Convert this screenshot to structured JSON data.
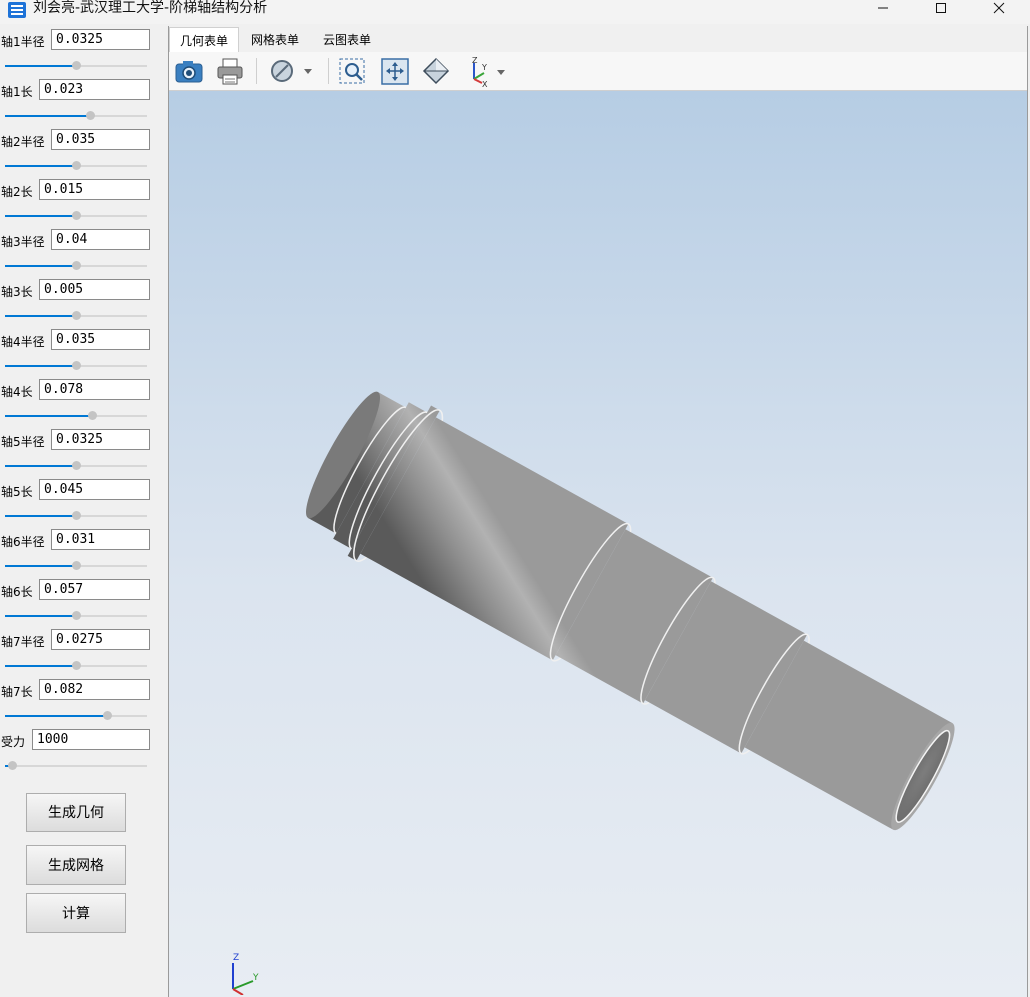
{
  "window": {
    "title": "刘会亮-武汉理工大学-阶梯轴结构分析",
    "controls": [
      "minimize-icon",
      "maximize-icon",
      "close-icon"
    ]
  },
  "params": [
    {
      "label": "轴1半径",
      "value": "0.0325",
      "slider": 0.5
    },
    {
      "label": "轴1长",
      "value": "0.023",
      "slider": 0.6
    },
    {
      "label": "轴2半径",
      "value": "0.035",
      "slider": 0.5
    },
    {
      "label": "轴2长",
      "value": "0.015",
      "slider": 0.5
    },
    {
      "label": "轴3半径",
      "value": "0.04",
      "slider": 0.5
    },
    {
      "label": "轴3长",
      "value": "0.005",
      "slider": 0.5
    },
    {
      "label": "轴4半径",
      "value": "0.035",
      "slider": 0.5
    },
    {
      "label": "轴4长",
      "value": "0.078",
      "slider": 0.61
    },
    {
      "label": "轴5半径",
      "value": "0.0325",
      "slider": 0.5
    },
    {
      "label": "轴5长",
      "value": "0.045",
      "slider": 0.5
    },
    {
      "label": "轴6半径",
      "value": "0.031",
      "slider": 0.5
    },
    {
      "label": "轴6长",
      "value": "0.057",
      "slider": 0.5
    },
    {
      "label": "轴7半径",
      "value": "0.0275",
      "slider": 0.5
    },
    {
      "label": "轴7长",
      "value": "0.082",
      "slider": 0.72
    },
    {
      "label": "受力",
      "value": "1000",
      "slider": 0.05
    }
  ],
  "buttons": {
    "generate_geometry": "生成几何",
    "generate_mesh": "生成网格",
    "compute": "计算"
  },
  "tabs": [
    {
      "label": "几何表单",
      "active": true
    },
    {
      "label": "网格表单",
      "active": false
    },
    {
      "label": "云图表单",
      "active": false
    }
  ],
  "toolbar": [
    "camera-icon",
    "print-icon",
    "display-mode-icon",
    "zoom-window-icon",
    "fit-all-icon",
    "view-cube-icon",
    "axis-view-icon"
  ],
  "axis_triad": {
    "z": "Z",
    "y": "Y"
  },
  "colors": {
    "accent": "#0078d4",
    "viewport_top": "#b6cde4",
    "viewport_bottom": "#e8edf3",
    "shaft": "#9a9a9a"
  }
}
